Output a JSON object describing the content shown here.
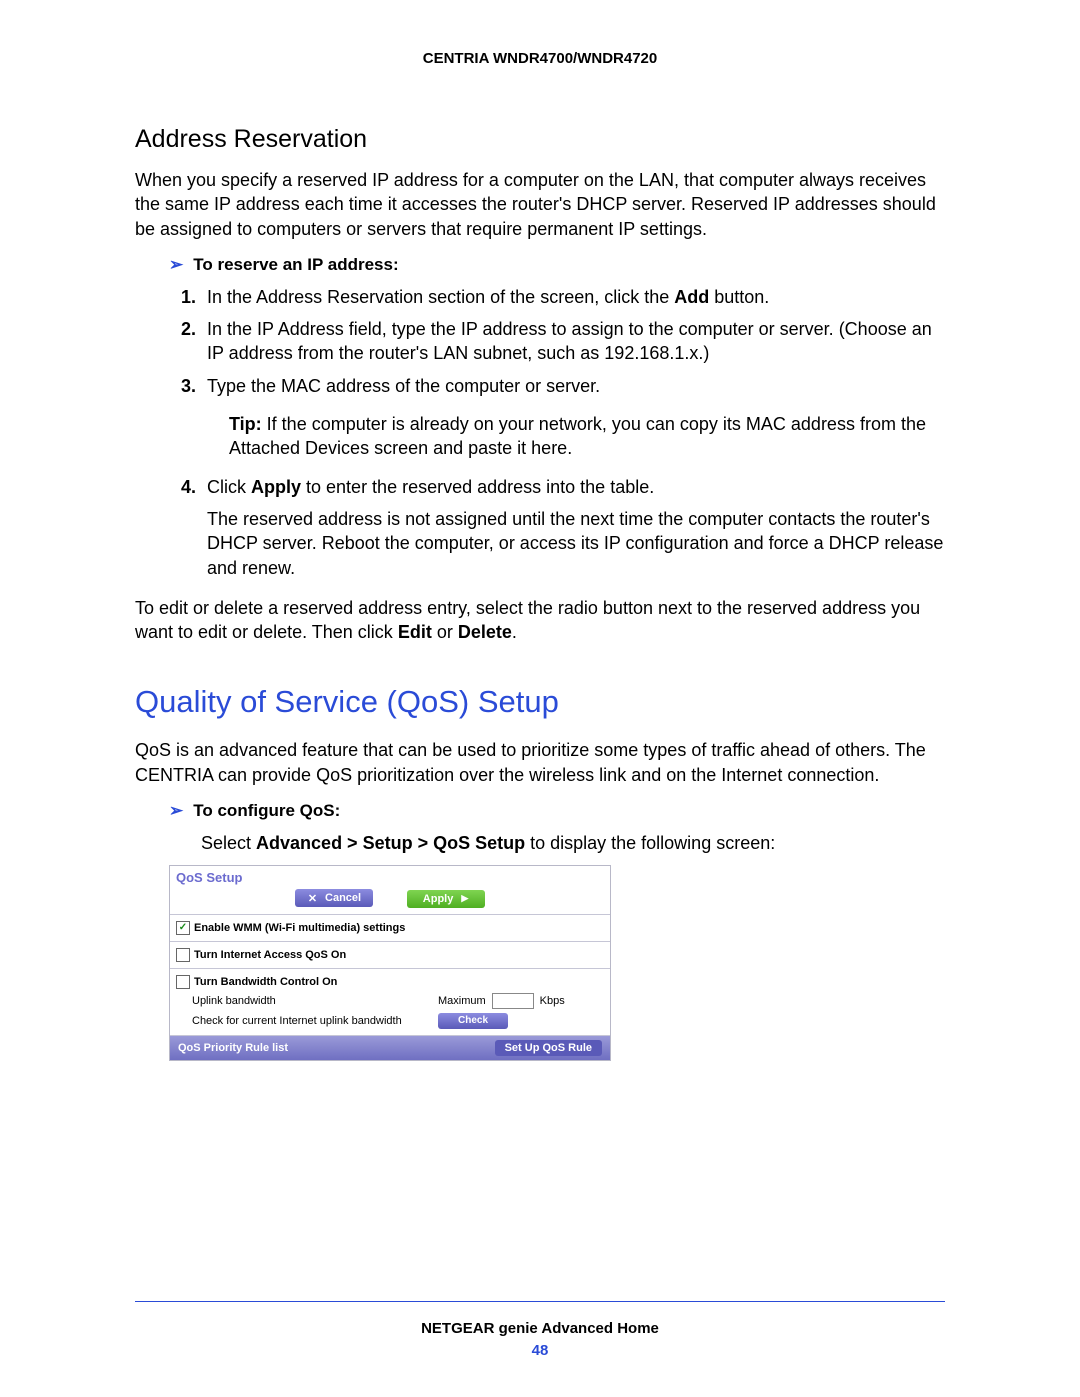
{
  "header": "CENTRIA WNDR4700/WNDR4720",
  "sec1": {
    "title": "Address Reservation",
    "intro": "When you specify a reserved IP address for a computer on the LAN, that computer always receives the same IP address each time it accesses the router's DHCP server. Reserved IP addresses should be assigned to computers or servers that require permanent IP settings.",
    "proc_title": "To reserve an IP address:",
    "step1_a": "In the Address Reservation section of the screen, click the ",
    "step1_b": "Add",
    "step1_c": " button.",
    "step2": "In the IP Address field, type the IP address to assign to the computer or server. (Choose an IP address from the router's LAN subnet, such as 192.168.1.x.)",
    "step3": "Type the MAC address of the computer or server.",
    "tip_label": "Tip:",
    "tip_text": "  If the computer is already on your network, you can copy its MAC address from the Attached Devices screen and paste it here.",
    "step4_a": "Click ",
    "step4_b": "Apply",
    "step4_c": " to enter the reserved address into the table.",
    "step4_note": "The reserved address is not assigned until the next time the computer contacts the router's DHCP server. Reboot the computer, or access its IP configuration and force a DHCP release and renew.",
    "edit_a": "To edit or delete a reserved address entry, select the radio button next to the reserved address you want to edit or delete. Then click ",
    "edit_b": "Edit",
    "edit_c": " or ",
    "edit_d": "Delete",
    "edit_e": "."
  },
  "sec2": {
    "title": "Quality of Service (QoS) Setup",
    "intro": "QoS is an advanced feature that can be used to prioritize some types of traffic ahead of others. The CENTRIA can provide QoS prioritization over the wireless link and on the Internet connection.",
    "proc_title": "To configure QoS:",
    "nav_a": "Select ",
    "nav_b": "Advanced > Setup > QoS Setup",
    "nav_c": " to display the following screen:"
  },
  "panel": {
    "title": "QoS Setup",
    "cancel": "Cancel",
    "apply": "Apply",
    "opt1": "Enable WMM (Wi-Fi multimedia) settings",
    "opt2": "Turn Internet Access QoS On",
    "opt3": "Turn Bandwidth Control On",
    "uplink_label": "Uplink bandwidth",
    "max": "Maximum",
    "kbps": "Kbps",
    "check_label": "Check for current Internet uplink bandwidth",
    "check_btn": "Check",
    "footer_label": "QoS Priority Rule list",
    "footer_btn": "Set Up QoS Rule"
  },
  "footer": {
    "text": "NETGEAR genie Advanced Home",
    "page": "48"
  }
}
